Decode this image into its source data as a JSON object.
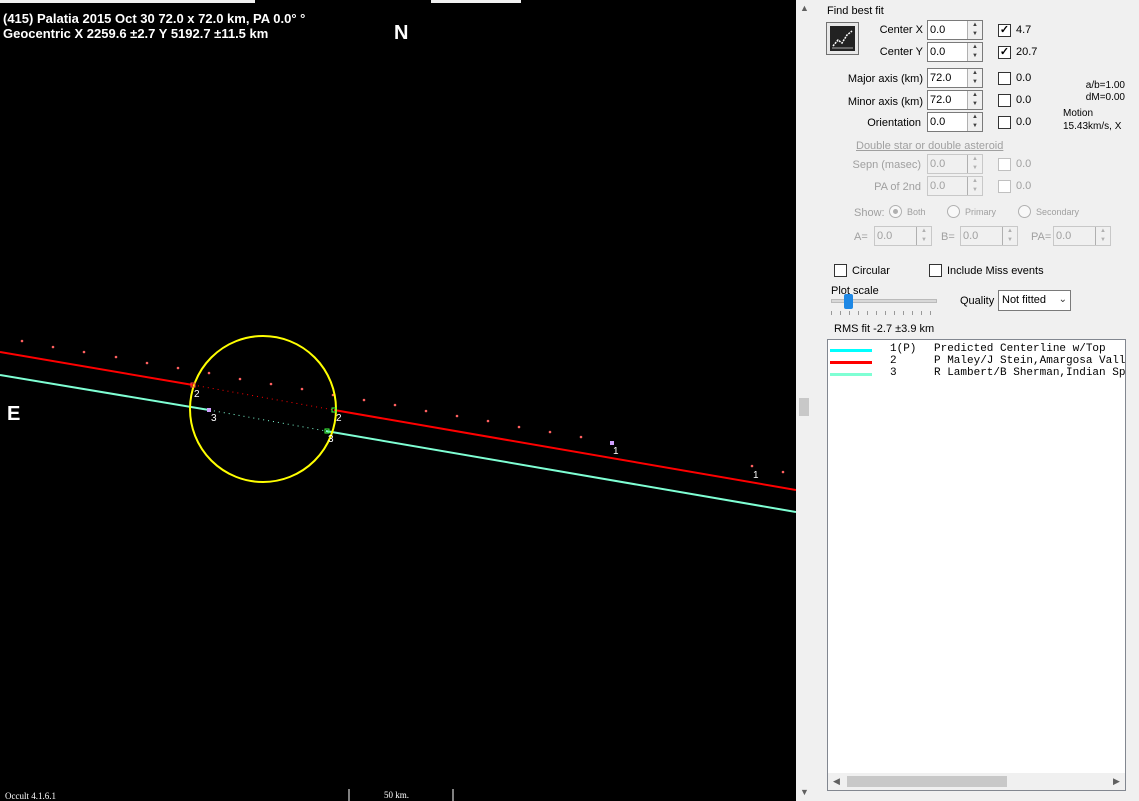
{
  "plot": {
    "title_line1": "(415) Palatia  2015 Oct 30   72.0 x 72.0 km,  PA 0.0° °",
    "title_line2": "Geocentric  X  2259.6 ±2.7  Y 5192.7 ±11.5 km",
    "north": "N",
    "east": "E",
    "footer_version": "Occult 4.1.6.1",
    "footer_scale": "50 km.",
    "chord_labels": {
      "obs2_a": "2",
      "obs3_a": "3",
      "obs2_b": "2",
      "obs3_b": "3",
      "pred1_a": "1",
      "pred1_b": "1"
    },
    "colors": {
      "ellipse": "#ffff00",
      "chord2": "#ff0000",
      "chord3": "#7fffd4",
      "dots": "#ff6060",
      "background": "#000000"
    }
  },
  "panel": {
    "heading": "Find best fit",
    "center_x": {
      "label": "Center X",
      "value": "0.0",
      "checked": true,
      "result": "4.7"
    },
    "center_y": {
      "label": "Center Y",
      "value": "0.0",
      "checked": true,
      "result": "20.7"
    },
    "major_axis": {
      "label": "Major axis (km)",
      "value": "72.0",
      "checked": false,
      "result": "0.0"
    },
    "minor_axis": {
      "label": "Minor axis (km)",
      "value": "72.0",
      "checked": false,
      "result": "0.0"
    },
    "orientation": {
      "label": "Orientation",
      "value": "0.0",
      "checked": false,
      "result": "0.0"
    },
    "info_ab": "a/b=1.00",
    "info_dm": "dM=0.00",
    "info_motion_label": "Motion",
    "info_motion_value": "15.43km/s, X",
    "double_star_heading": "Double star  or  double asteroid",
    "sepn": {
      "label": "Sepn (masec)",
      "value": "0.0",
      "result": "0.0"
    },
    "pa2": {
      "label": "PA of 2nd",
      "value": "0.0",
      "result": "0.0"
    },
    "show_label": "Show:",
    "show_both": "Both",
    "show_primary": "Primary",
    "show_secondary": "Secondary",
    "a_label": "A=",
    "a_value": "0.0",
    "b_label": "B=",
    "b_value": "0.0",
    "pa_label": "PA=",
    "pa_value": "0.0",
    "circular_label": "Circular",
    "include_miss_label": "Include Miss events",
    "plot_scale_label": "Plot scale",
    "plot_scale_value": 0.12,
    "quality_label": "Quality",
    "quality_value": "Not fitted",
    "rms_fit": "RMS fit -2.7 ±3.9 km"
  },
  "legend": {
    "rows": [
      {
        "color": "#00ffff",
        "num": "1(P)",
        "text": "Predicted Centerline w/Top"
      },
      {
        "color": "#ff0000",
        "num": "2",
        "text": "P Maley/J Stein,Amargosa Valley"
      },
      {
        "color": "#7fffd4",
        "num": "3",
        "text": "R Lambert/B Sherman,Indian Springs"
      }
    ]
  }
}
